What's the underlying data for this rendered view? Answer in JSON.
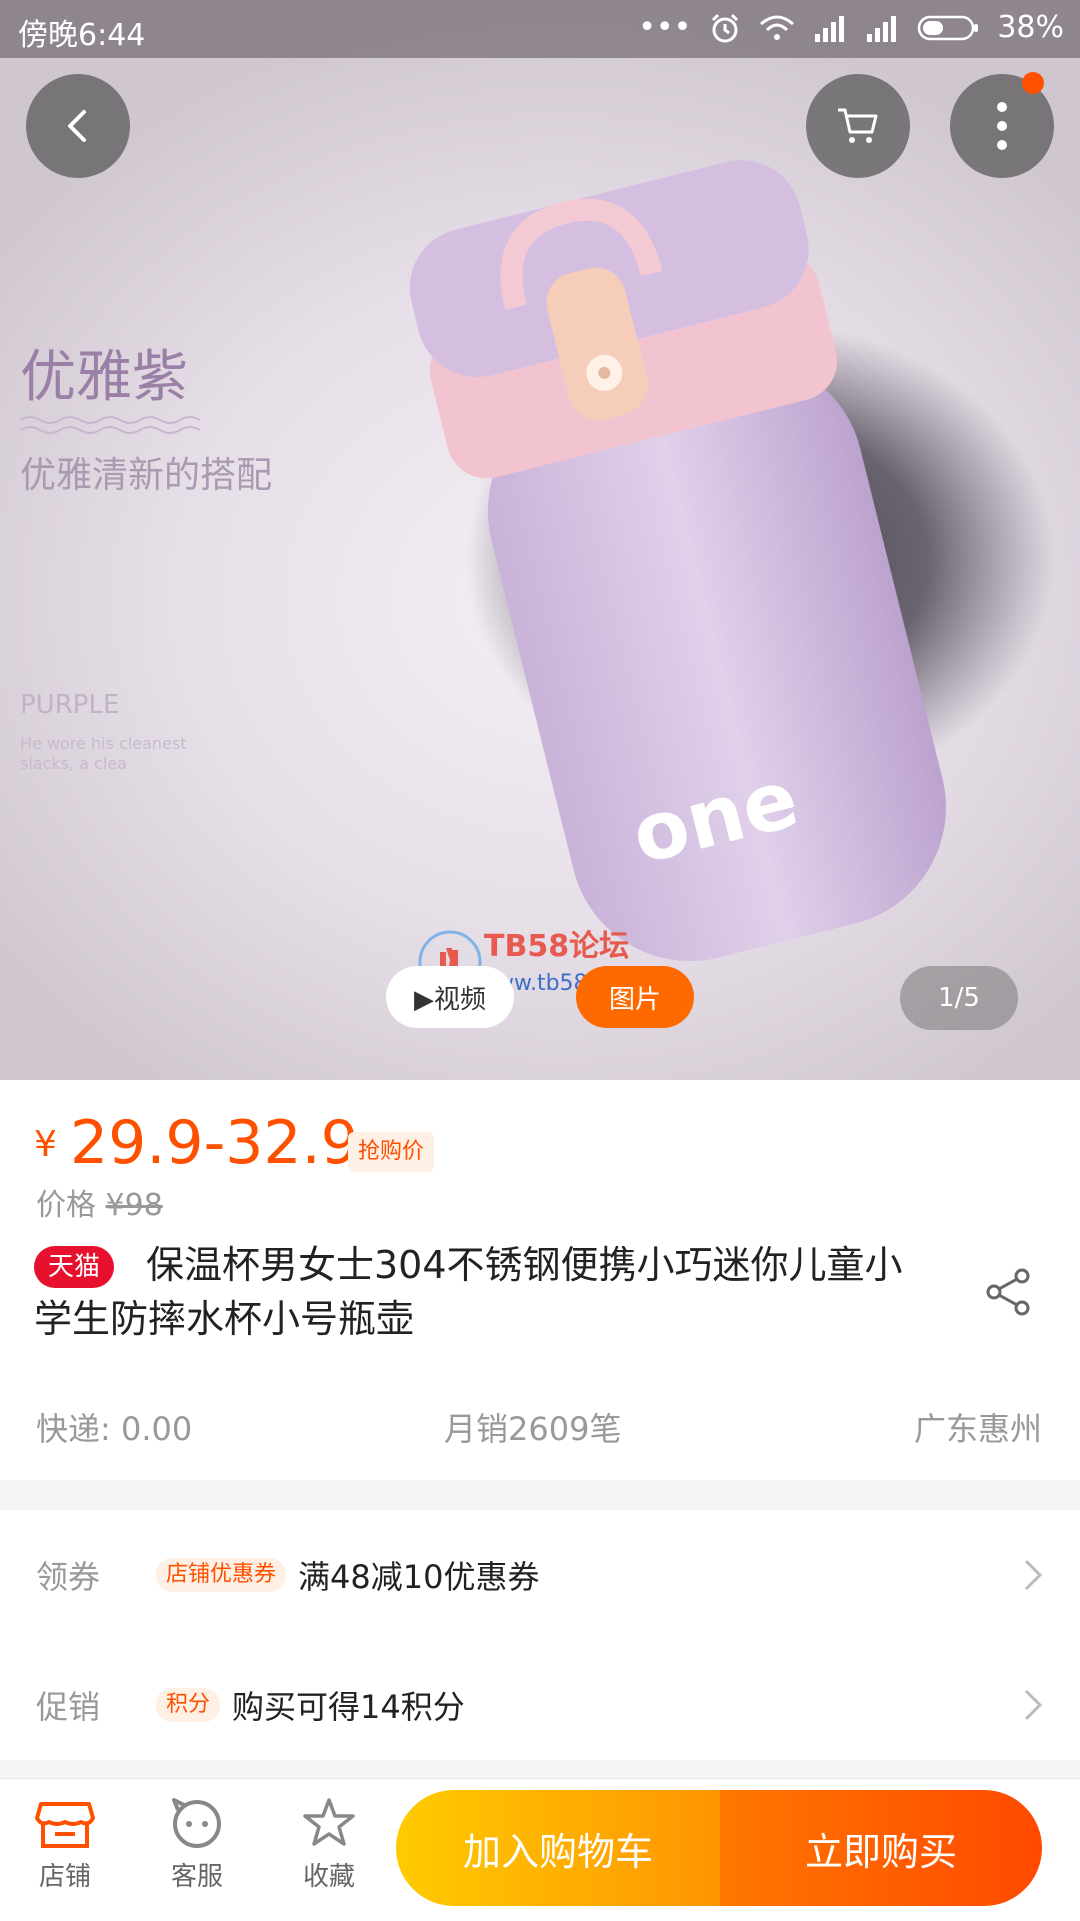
{
  "status_bar": {
    "time": "傍晚6:44",
    "dots": "•••",
    "battery": "38%"
  },
  "hero": {
    "overlay_title": "优雅紫",
    "overlay_subtitle": "优雅清新的搭配",
    "overlay_english": "PURPLE",
    "overlay_small_text": "He wore his cleanest slacks, a clea",
    "bottle_text": "one",
    "video_label": "▶视频",
    "image_label": "图片",
    "counter": "1/5",
    "watermark_title": "TB58论坛",
    "watermark_url": "www.tb58.net"
  },
  "price": {
    "symbol": "¥",
    "range": "29.9-32.9",
    "tag": "抢购价",
    "original_label": "价格",
    "original_value": "¥98"
  },
  "product": {
    "badge": "天猫",
    "title": "保温杯男女士304不锈钢便携小巧迷你儿童小学生防摔水杯小号瓶壶"
  },
  "meta": {
    "shipping": "快递: 0.00",
    "monthly_sales": "月销2609笔",
    "location": "广东惠州"
  },
  "rows": [
    {
      "label": "领券",
      "tag": "店铺优惠券",
      "text": "满48减10优惠券"
    },
    {
      "label": "促销",
      "tag": "积分",
      "text": "购买可得14积分"
    }
  ],
  "bottom_nav": {
    "store": "店铺",
    "service": "客服",
    "favorite": "收藏",
    "add_to_cart": "加入购物车",
    "buy_now": "立即购买"
  },
  "colors": {
    "accent": "#ff5000",
    "tmall_red": "#e8112d",
    "cart_yellow": "#ffcb00",
    "buy_orange": "#ff4900"
  }
}
